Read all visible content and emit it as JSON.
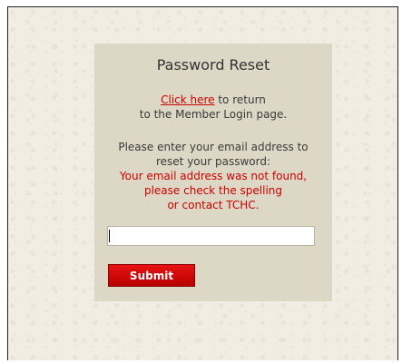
{
  "reset": {
    "title": "Password Reset",
    "link_text": "Click here",
    "return_line1_rest": " to return",
    "return_line2": "to the Member Login page.",
    "prompt_line1": "Please enter your email address to",
    "prompt_line2": "reset your password:",
    "error_line1": "Your email address was not found,",
    "error_line2": "please check the spelling",
    "error_line3": "or contact TCHC.",
    "email_value": "",
    "submit_label": "Submit"
  },
  "colors": {
    "link": "#cc0000",
    "error": "#cc0000",
    "submit_bg": "#cc0000",
    "panel_bg": "#ddd8c5",
    "page_bg": "#f1ede3"
  }
}
